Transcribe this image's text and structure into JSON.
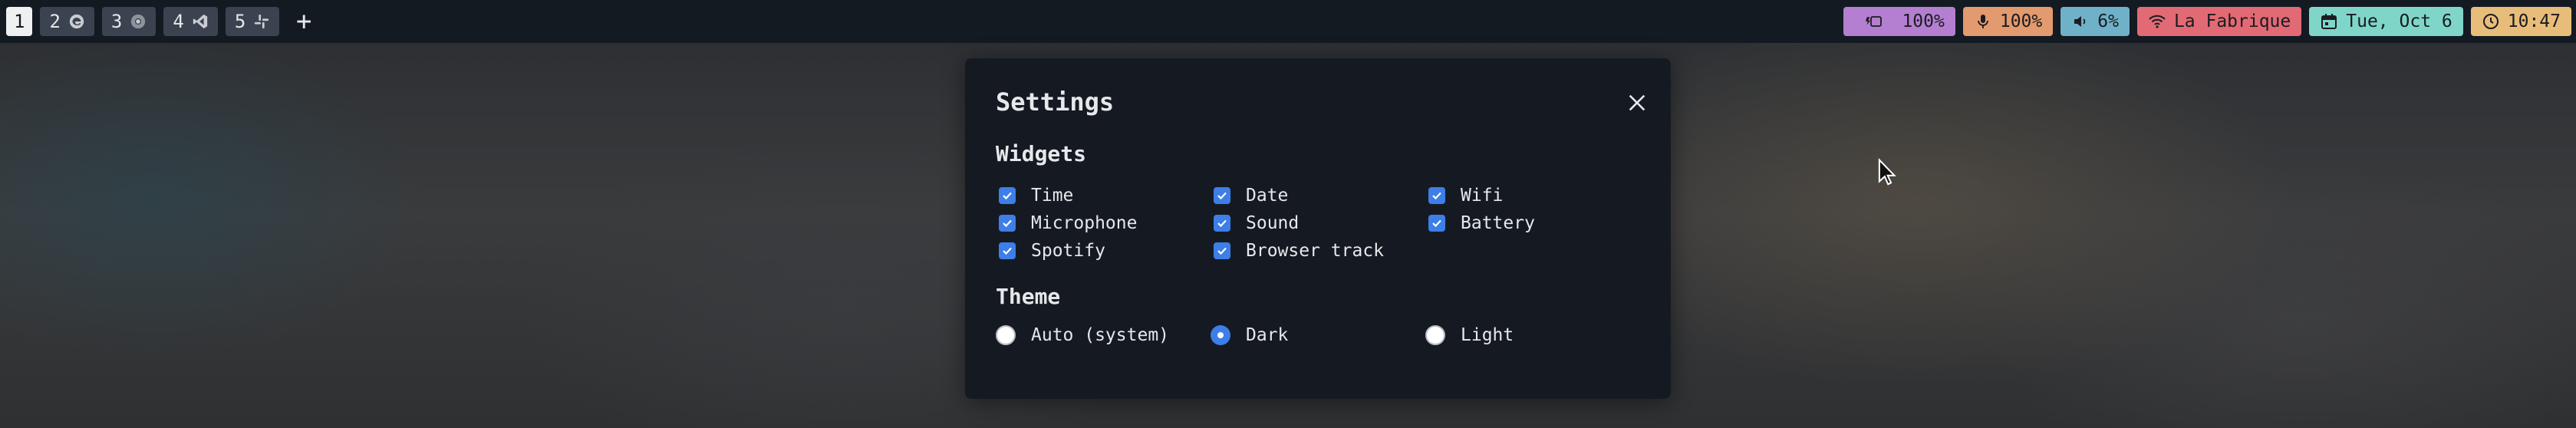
{
  "workspaces": [
    {
      "number": "1",
      "icon": "",
      "active": true
    },
    {
      "number": "2",
      "icon": "edge-browser-icon",
      "active": false
    },
    {
      "number": "3",
      "icon": "chrome-icon",
      "active": false
    },
    {
      "number": "4",
      "icon": "vscode-icon",
      "active": false
    },
    {
      "number": "5",
      "icon": "slack-icon",
      "active": false
    }
  ],
  "add_workspace_label": "+",
  "status": {
    "battery": {
      "text": "100%",
      "color": "#b47fd0",
      "icon": "battery-icon"
    },
    "microphone": {
      "text": "100%",
      "color": "#e39a6e",
      "icon": "microphone-icon"
    },
    "sound": {
      "text": "6%",
      "color": "#6fb1c8",
      "icon": "speaker-icon"
    },
    "wifi": {
      "text": "La Fabrique",
      "color": "#e26a75",
      "icon": "wifi-icon"
    },
    "date": {
      "text": "Tue, Oct 6",
      "color": "#7fd6c8",
      "icon": "calendar-icon"
    },
    "time": {
      "text": "10:47",
      "color": "#e8bd7a",
      "icon": "clock-icon"
    }
  },
  "settings": {
    "title": "Settings",
    "widgets": {
      "heading": "Widgets",
      "items": [
        {
          "label": "Time",
          "checked": true
        },
        {
          "label": "Date",
          "checked": true
        },
        {
          "label": "Wifi",
          "checked": true
        },
        {
          "label": "Microphone",
          "checked": true
        },
        {
          "label": "Sound",
          "checked": true
        },
        {
          "label": "Battery",
          "checked": true
        },
        {
          "label": "Spotify",
          "checked": true
        },
        {
          "label": "Browser track",
          "checked": true
        }
      ]
    },
    "theme": {
      "heading": "Theme",
      "options": [
        {
          "label": "Auto (system)",
          "selected": false
        },
        {
          "label": "Dark",
          "selected": true
        },
        {
          "label": "Light",
          "selected": false
        }
      ]
    }
  },
  "colors": {
    "accent": "#3d7ee8",
    "bar_bg": "#141a22",
    "dialog_bg": "#151a22"
  }
}
